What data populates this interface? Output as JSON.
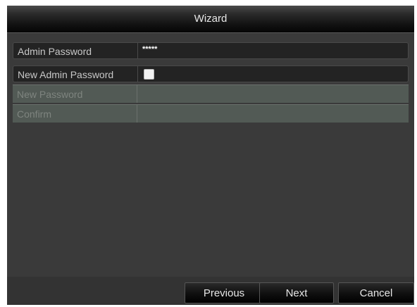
{
  "window": {
    "title": "Wizard"
  },
  "form": {
    "admin_password": {
      "label": "Admin Password",
      "value": "*****"
    },
    "new_admin_password": {
      "label": "New Admin Password",
      "checked": false
    },
    "new_password": {
      "label": "New Password",
      "value": ""
    },
    "confirm": {
      "label": "Confirm",
      "value": ""
    }
  },
  "buttons": {
    "previous": "Previous",
    "next": "Next",
    "cancel": "Cancel"
  }
}
